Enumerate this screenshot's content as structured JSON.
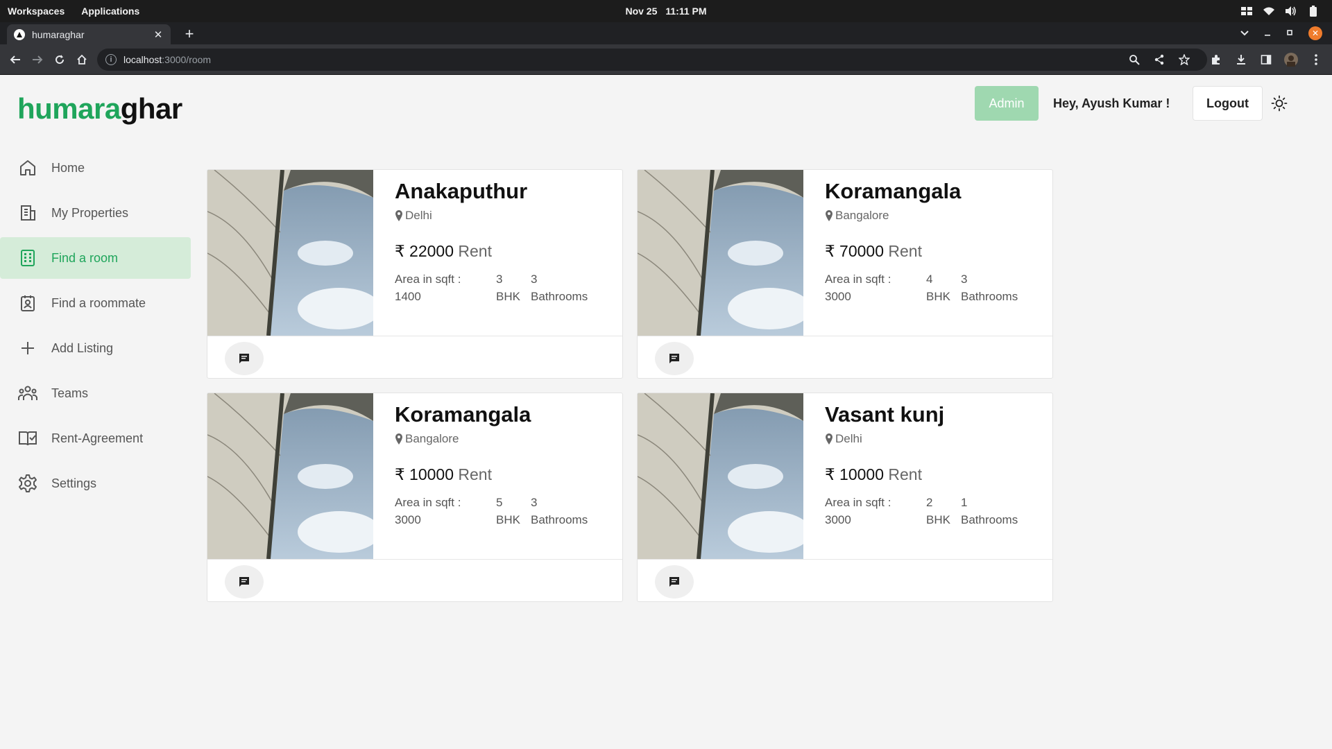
{
  "os": {
    "workspaces": "Workspaces",
    "applications": "Applications",
    "date": "Nov 25",
    "time": "11:11 PM"
  },
  "browser": {
    "tab_title": "humaraghar",
    "url_host": "localhost",
    "url_path": ":3000/room"
  },
  "header": {
    "logo_part1": "humara",
    "logo_part2": "ghar",
    "admin_label": "Admin",
    "greeting": "Hey, Ayush Kumar !",
    "logout_label": "Logout"
  },
  "sidebar": {
    "items": [
      {
        "label": "Home",
        "icon": "home-icon"
      },
      {
        "label": "My Properties",
        "icon": "building-icon"
      },
      {
        "label": "Find a room",
        "icon": "grid-building-icon"
      },
      {
        "label": "Find a roommate",
        "icon": "contact-card-icon"
      },
      {
        "label": "Add Listing",
        "icon": "plus-icon"
      },
      {
        "label": "Teams",
        "icon": "people-icon"
      },
      {
        "label": "Rent-Agreement",
        "icon": "book-icon"
      },
      {
        "label": "Settings",
        "icon": "gear-icon"
      }
    ],
    "active_index": 2
  },
  "listings": [
    {
      "title": "Anakaputhur",
      "location": "Delhi",
      "currency": "₹",
      "price": "22000",
      "rent_label": "Rent",
      "area_label": "Area in sqft :",
      "area": "1400",
      "bhk": "3",
      "bhk_label": "BHK",
      "baths": "3",
      "baths_label": "Bathrooms"
    },
    {
      "title": "Koramangala",
      "location": "Bangalore",
      "currency": "₹",
      "price": "70000",
      "rent_label": "Rent",
      "area_label": "Area in sqft :",
      "area": "3000",
      "bhk": "4",
      "bhk_label": "BHK",
      "baths": "3",
      "baths_label": "Bathrooms"
    },
    {
      "title": "Koramangala",
      "location": "Bangalore",
      "currency": "₹",
      "price": "10000",
      "rent_label": "Rent",
      "area_label": "Area in sqft :",
      "area": "3000",
      "bhk": "5",
      "bhk_label": "BHK",
      "baths": "3",
      "baths_label": "Bathrooms"
    },
    {
      "title": "Vasant kunj",
      "location": "Delhi",
      "currency": "₹",
      "price": "10000",
      "rent_label": "Rent",
      "area_label": "Area in sqft :",
      "area": "3000",
      "bhk": "2",
      "bhk_label": "BHK",
      "baths": "1",
      "baths_label": "Bathrooms"
    }
  ],
  "colors": {
    "brand_green": "#1fa55b",
    "active_bg": "#d5ecd9",
    "admin_bg": "#9fd8b0"
  }
}
